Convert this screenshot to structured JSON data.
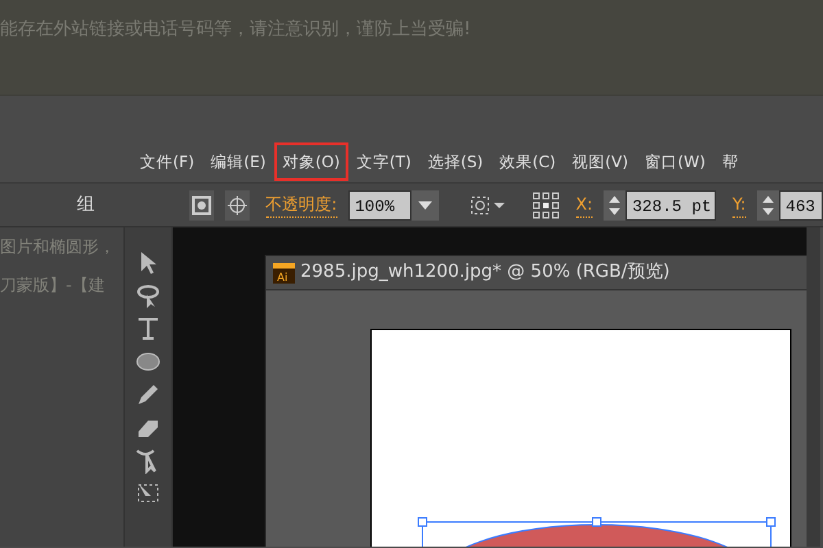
{
  "notice": "能存在外站链接或电话号码等，请注意识别，谨防上当受骗!",
  "menu": [
    {
      "label": "文件(F)",
      "highlighted": false
    },
    {
      "label": "编辑(E)",
      "highlighted": false
    },
    {
      "label": "对象(O)",
      "highlighted": true
    },
    {
      "label": "文字(T)",
      "highlighted": false
    },
    {
      "label": "选择(S)",
      "highlighted": false
    },
    {
      "label": "效果(C)",
      "highlighted": false
    },
    {
      "label": "视图(V)",
      "highlighted": false
    },
    {
      "label": "窗口(W)",
      "highlighted": false
    },
    {
      "label": "帮",
      "highlighted": false
    }
  ],
  "control_bar": {
    "group_label": "组",
    "opacity_label": "不透明度:",
    "opacity_value": "100%",
    "x_label": "X:",
    "x_value": "328.5 pt",
    "y_label": "Y:",
    "y_value": "463"
  },
  "article_lines": [
    "图片和椭圆形，",
    "刀蒙版】-【建"
  ],
  "document": {
    "icon_text": "Ai",
    "title": "2985.jpg_wh1200.jpg* @ 50% (RGB/预览)"
  }
}
